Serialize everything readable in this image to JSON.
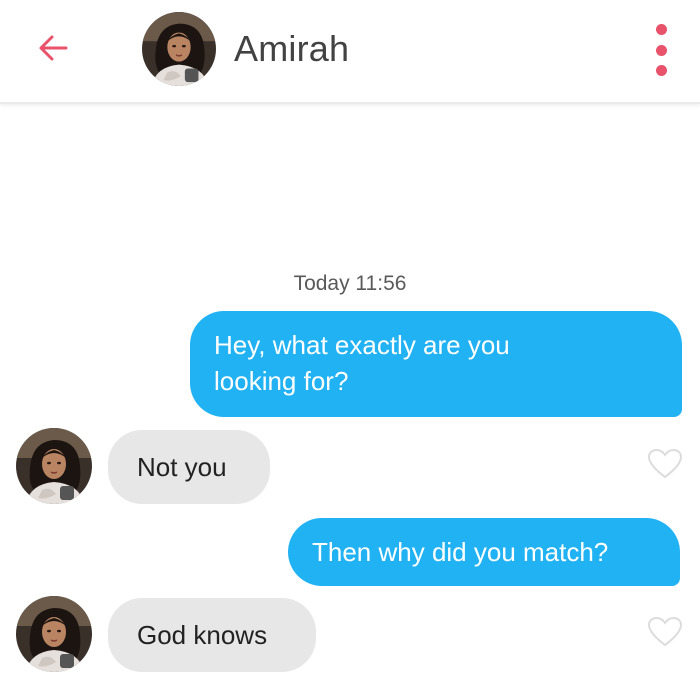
{
  "header": {
    "contact_name": "Amirah"
  },
  "conversation": {
    "timestamp": "Today 11:56",
    "messages": [
      {
        "direction": "sent",
        "text_lines": [
          "Hey, what exactly are you",
          "looking for?"
        ]
      },
      {
        "direction": "received",
        "text": "Not you"
      },
      {
        "direction": "sent",
        "text": "Then why did you match?"
      },
      {
        "direction": "received",
        "text": "God knows"
      }
    ]
  },
  "colors": {
    "accent": "#e8526a",
    "sent_bubble": "#21b2f4",
    "received_bubble": "#e7e7e7",
    "name_text": "#424242"
  },
  "icons": {
    "back": "arrow-left-icon",
    "menu": "more-vertical-icon",
    "like": "heart-outline-icon"
  }
}
